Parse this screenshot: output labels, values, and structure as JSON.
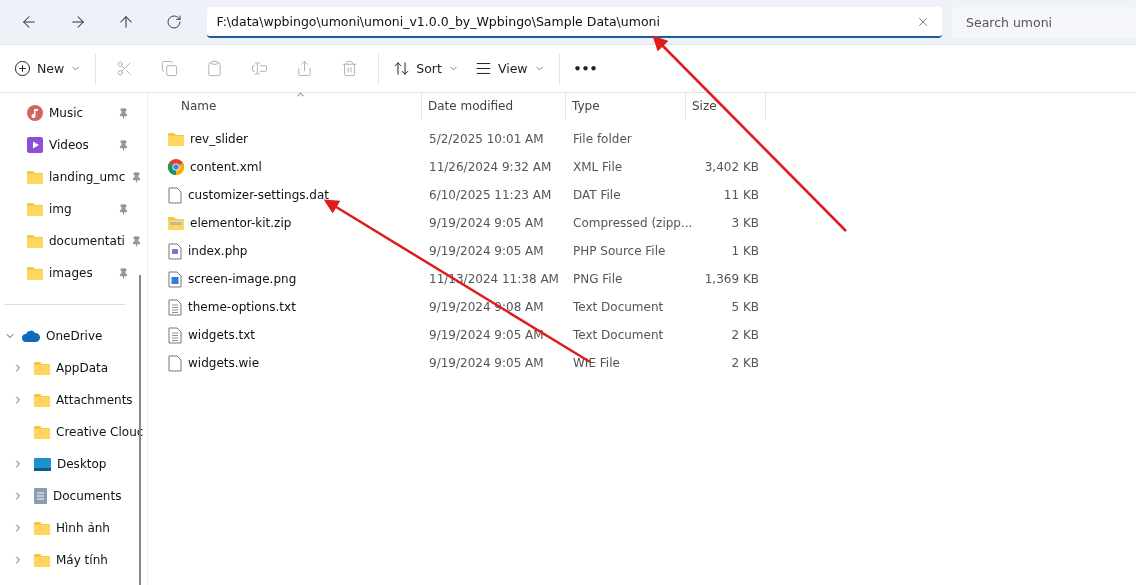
{
  "address_bar": {
    "path": "F:\\data\\wpbingo\\umoni\\umoni_v1.0.0_by_Wpbingo\\Sample Data\\umoni"
  },
  "search": {
    "placeholder": "Search umoni"
  },
  "toolbar": [
    {
      "kind": "new",
      "label": "New",
      "disabled": false
    },
    {
      "kind": "cut",
      "disabled": true
    },
    {
      "kind": "copy",
      "disabled": true
    },
    {
      "kind": "paste",
      "disabled": true
    },
    {
      "kind": "rename",
      "disabled": true
    },
    {
      "kind": "share",
      "disabled": true
    },
    {
      "kind": "delete",
      "disabled": true
    },
    {
      "kind": "sort",
      "label": "Sort",
      "disabled": false
    },
    {
      "kind": "view",
      "label": "View",
      "disabled": false
    },
    {
      "kind": "more",
      "label": "•••",
      "disabled": false
    }
  ],
  "sidebar": {
    "quick_access": [
      {
        "name": "Music",
        "kind": "music",
        "pinned": true
      },
      {
        "name": "Videos",
        "kind": "video",
        "pinned": true
      },
      {
        "name": "landing_umc",
        "kind": "folder",
        "pinned": true
      },
      {
        "name": "img",
        "kind": "folder",
        "pinned": true
      },
      {
        "name": "documentati",
        "kind": "folder",
        "pinned": true
      },
      {
        "name": "images",
        "kind": "folder",
        "pinned": true
      }
    ],
    "tree": [
      {
        "name": "OneDrive",
        "kind": "cloud",
        "expanded": true,
        "children": [
          {
            "name": "AppData",
            "kind": "folder",
            "has_children": true
          },
          {
            "name": "Attachments",
            "kind": "folder",
            "has_children": true
          },
          {
            "name": "Creative Clouc",
            "kind": "folder",
            "has_children": false
          },
          {
            "name": "Desktop",
            "kind": "desktop",
            "has_children": true
          },
          {
            "name": "Documents",
            "kind": "documents",
            "has_children": true
          },
          {
            "name": "Hình ảnh",
            "kind": "folder",
            "has_children": true
          },
          {
            "name": "Máy tính",
            "kind": "folder",
            "has_children": true
          }
        ]
      }
    ]
  },
  "table": {
    "columns": [
      {
        "label": "Name",
        "sorted": true
      },
      {
        "label": "Date modified",
        "sorted": false
      },
      {
        "label": "Type",
        "sorted": false
      },
      {
        "label": "Size",
        "sorted": false
      }
    ],
    "rows": [
      {
        "name": "rev_slider",
        "kind": "folder",
        "date": "5/2/2025 10:01 AM",
        "type": "File folder"
      },
      {
        "name": "content.xml",
        "kind": "chrome",
        "date": "11/26/2024 9:32 AM",
        "type": "XML File",
        "size": "3,402 KB"
      },
      {
        "name": "customizer-settings.dat",
        "kind": "file",
        "date": "6/10/2025 11:23 AM",
        "type": "DAT File",
        "size": "11 KB"
      },
      {
        "name": "elementor-kit.zip",
        "kind": "zip",
        "date": "9/19/2024 9:05 AM",
        "type": "Compressed (zipp...",
        "size": "3 KB"
      },
      {
        "name": "index.php",
        "kind": "php",
        "date": "9/19/2024 9:05 AM",
        "type": "PHP Source File",
        "size": "1 KB"
      },
      {
        "name": "screen-image.png",
        "kind": "image",
        "date": "11/13/2024 11:38 AM",
        "type": "PNG File",
        "size": "1,369 KB"
      },
      {
        "name": "theme-options.txt",
        "kind": "text",
        "date": "9/19/2024 9:08 AM",
        "type": "Text Document",
        "size": "5 KB"
      },
      {
        "name": "widgets.txt",
        "kind": "text",
        "date": "9/19/2024 9:05 AM",
        "type": "Text Document",
        "size": "2 KB"
      },
      {
        "name": "widgets.wie",
        "kind": "file",
        "date": "9/19/2024 9:05 AM",
        "type": "WIE File",
        "size": "2 KB"
      }
    ]
  }
}
